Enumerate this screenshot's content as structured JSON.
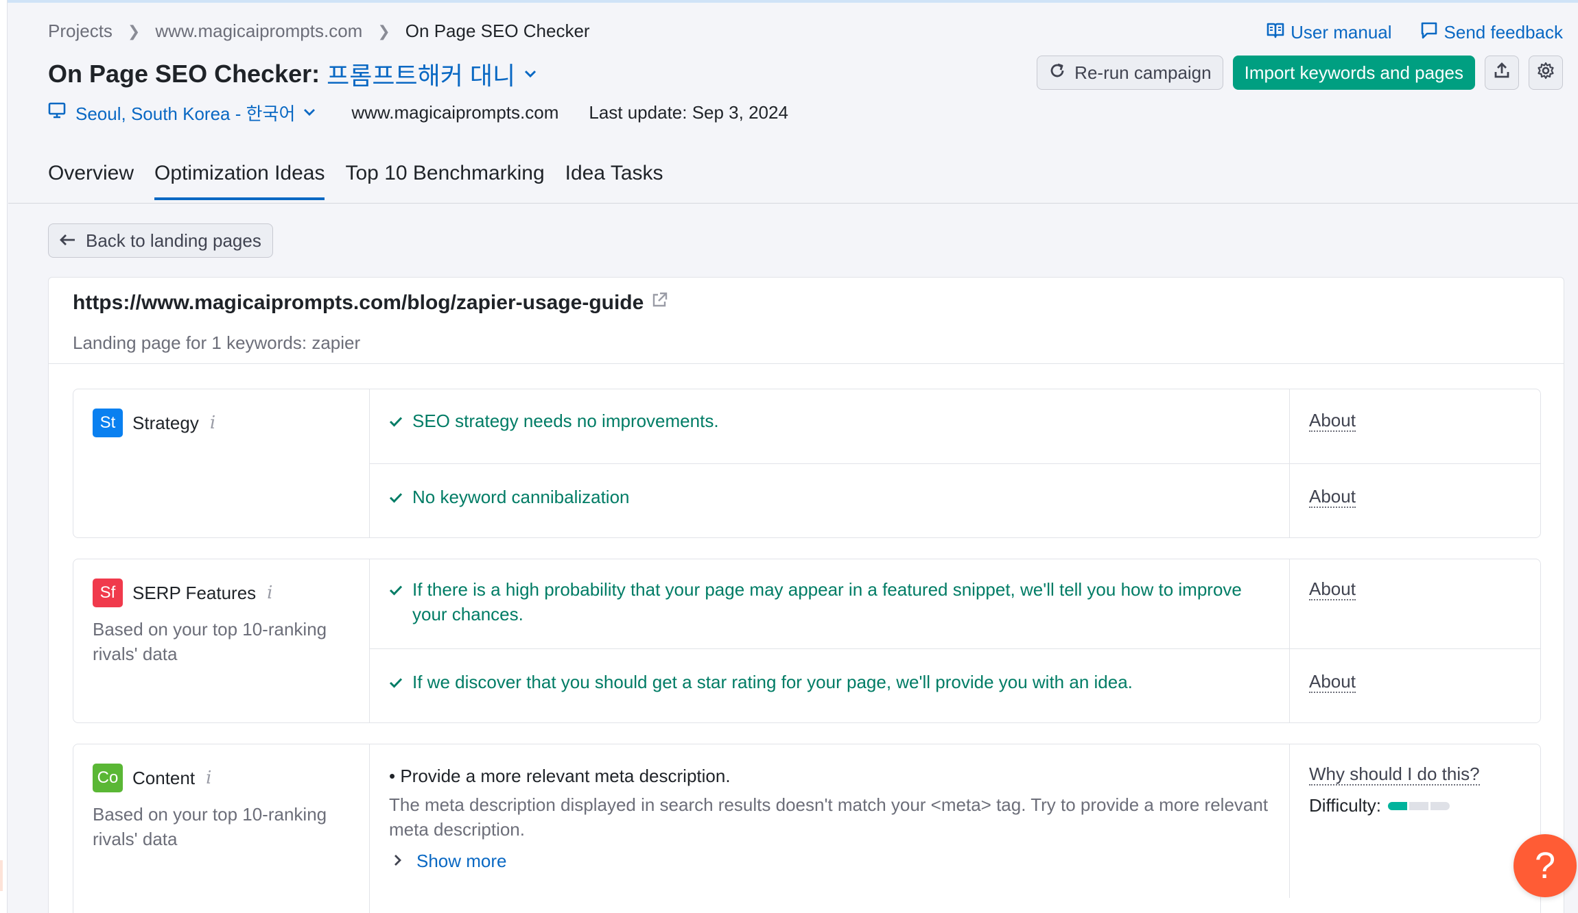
{
  "breadcrumb": {
    "items": [
      "Projects",
      "www.magicaiprompts.com",
      "On Page SEO Checker"
    ]
  },
  "header": {
    "title": "On Page SEO Checker:",
    "project_name": "프롬프트해커 대니",
    "location": "Seoul, South Korea - 한국어",
    "domain": "www.magicaiprompts.com",
    "last_update": "Last update: Sep 3, 2024"
  },
  "top_links": {
    "user_manual": "User manual",
    "send_feedback": "Send feedback"
  },
  "actions": {
    "rerun": "Re-run campaign",
    "import": "Import keywords and pages",
    "export_icon": "upload-icon",
    "settings_icon": "gear-icon"
  },
  "tabs": [
    {
      "label": "Overview",
      "active": false
    },
    {
      "label": "Optimization Ideas",
      "active": true
    },
    {
      "label": "Top 10 Benchmarking",
      "active": false
    },
    {
      "label": "Idea Tasks",
      "active": false
    }
  ],
  "back_button": "Back to landing pages",
  "page": {
    "url": "https://www.magicaiprompts.com/blog/zapier-usage-guide",
    "landing_info": "Landing page for 1 keywords: zapier"
  },
  "sections": {
    "strategy": {
      "badge": "St",
      "badge_color": "#0a80f0",
      "title": "Strategy",
      "rows": [
        {
          "text": "SEO strategy needs no improvements.",
          "link": "About"
        },
        {
          "text": "No keyword cannibalization",
          "link": "About"
        }
      ]
    },
    "serp": {
      "badge": "Sf",
      "badge_color": "#f03a4c",
      "title": "SERP Features",
      "desc": "Based on your top 10-ranking rivals' data",
      "rows": [
        {
          "text": "If there is a high probability that your page may appear in a featured snippet, we'll tell you how to improve your chances.",
          "link": "About"
        },
        {
          "text": "If we discover that you should get a star rating for your page, we'll provide you with an idea.",
          "link": "About"
        }
      ]
    },
    "content": {
      "badge": "Co",
      "badge_color": "#5ab735",
      "title": "Content",
      "desc": "Based on your top 10-ranking rivals' data",
      "idea_title": "• Provide a more relevant meta description.",
      "idea_desc": "The meta description displayed in search results doesn't match your <meta> tag. Try to provide a more relevant meta description.",
      "show_more": "Show more",
      "why_link": "Why should I do this?",
      "difficulty_label": "Difficulty:",
      "difficulty_level": 1,
      "difficulty_max": 3
    }
  },
  "help_button": "?"
}
